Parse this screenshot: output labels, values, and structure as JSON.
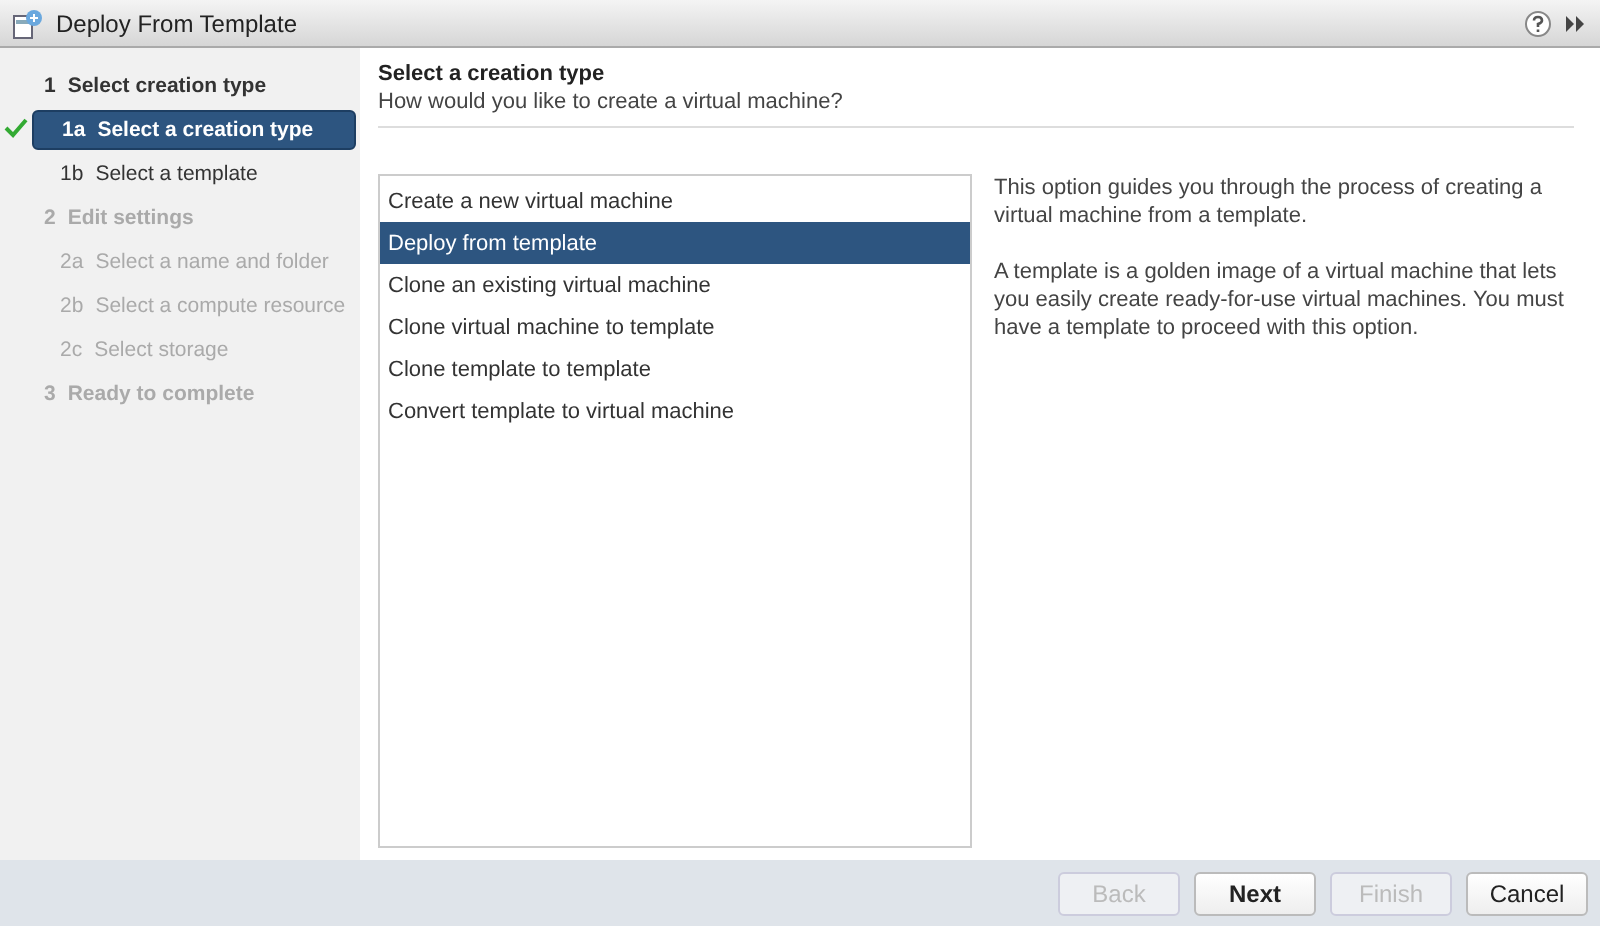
{
  "window": {
    "title": "Deploy From Template"
  },
  "steps": [
    {
      "number": "1",
      "label": "Select creation type",
      "disabled": false,
      "children": [
        {
          "number": "1a",
          "label": "Select a creation type",
          "selected": true,
          "done": true,
          "disabled": false
        },
        {
          "number": "1b",
          "label": "Select a template",
          "selected": false,
          "done": false,
          "disabled": false
        }
      ]
    },
    {
      "number": "2",
      "label": "Edit settings",
      "disabled": true,
      "children": [
        {
          "number": "2a",
          "label": "Select a name and folder",
          "selected": false,
          "done": false,
          "disabled": true
        },
        {
          "number": "2b",
          "label": "Select a compute resource",
          "selected": false,
          "done": false,
          "disabled": true
        },
        {
          "number": "2c",
          "label": "Select storage",
          "selected": false,
          "done": false,
          "disabled": true
        }
      ]
    },
    {
      "number": "3",
      "label": "Ready to complete",
      "disabled": true
    }
  ],
  "page": {
    "title": "Select a creation type",
    "subtitle": "How would you like to create a virtual machine?"
  },
  "options": [
    {
      "label": "Create a new virtual machine",
      "selected": false
    },
    {
      "label": "Deploy from template",
      "selected": true
    },
    {
      "label": "Clone an existing virtual machine",
      "selected": false
    },
    {
      "label": "Clone virtual machine to template",
      "selected": false
    },
    {
      "label": "Clone template to template",
      "selected": false
    },
    {
      "label": "Convert template to virtual machine",
      "selected": false
    }
  ],
  "description": [
    "This option guides you through the process of creating a virtual machine from a template.",
    "A template is a golden image of a virtual machine that lets you easily create ready-for-use virtual machines. You must have a template to proceed with this option."
  ],
  "buttons": [
    {
      "label": "Back",
      "disabled": true
    },
    {
      "label": "Next",
      "disabled": false
    },
    {
      "label": "Finish",
      "disabled": true
    },
    {
      "label": "Cancel",
      "disabled": false
    }
  ]
}
